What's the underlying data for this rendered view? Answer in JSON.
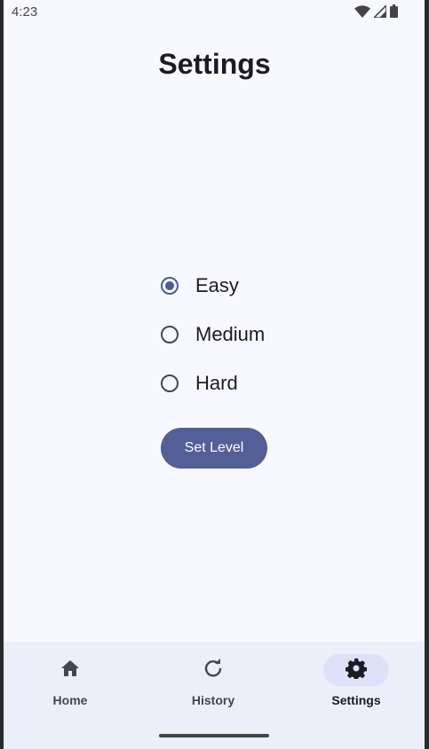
{
  "status_bar": {
    "time": "4:23"
  },
  "page": {
    "title": "Settings"
  },
  "difficulty": {
    "options": [
      {
        "label": "Easy",
        "selected": true
      },
      {
        "label": "Medium",
        "selected": false
      },
      {
        "label": "Hard",
        "selected": false
      }
    ]
  },
  "actions": {
    "set_level_label": "Set Level"
  },
  "bottom_nav": {
    "items": [
      {
        "label": "Home",
        "icon": "home-icon",
        "active": false
      },
      {
        "label": "History",
        "icon": "refresh-icon",
        "active": false
      },
      {
        "label": "Settings",
        "icon": "gear-icon",
        "active": true
      }
    ]
  },
  "colors": {
    "accent": "#545e97",
    "background": "#f8f9fe",
    "nav_background": "#eceef9",
    "active_pill": "#dee1f9"
  }
}
